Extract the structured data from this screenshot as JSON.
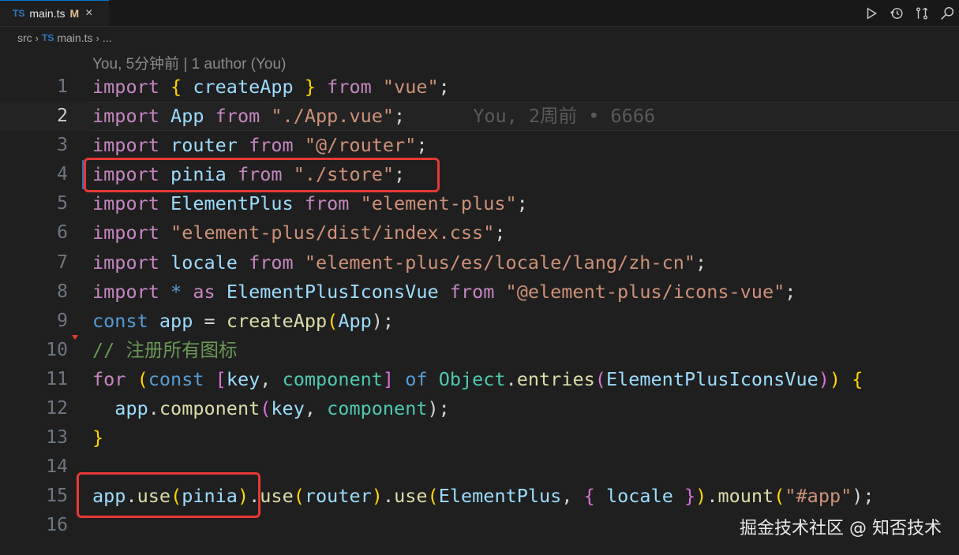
{
  "tab": {
    "badge": "TS",
    "name": "main.ts",
    "modified": "M",
    "close": "×"
  },
  "breadcrumb": {
    "folder": "src",
    "sep1": "›",
    "badge": "TS",
    "file": "main.ts",
    "sep2": "›",
    "more": "..."
  },
  "toolbar": {
    "icons": [
      "run-icon",
      "history-icon",
      "compare-icon",
      "open-changes-icon"
    ]
  },
  "blame_header": "You, 5分钟前 | 1 author (You)",
  "inline_blame": "You, 2周前 • 6666",
  "watermark": "掘金技术社区 @ 知否技术",
  "line_numbers": [
    "1",
    "2",
    "3",
    "4",
    "5",
    "6",
    "7",
    "8",
    "9",
    "10",
    "11",
    "12",
    "13",
    "14",
    "15",
    "16"
  ],
  "code": {
    "l1": [
      "import",
      " ",
      "{",
      " ",
      "createApp",
      " ",
      "}",
      " ",
      "from",
      " ",
      "\"vue\"",
      ";"
    ],
    "l2": [
      "import",
      " ",
      "App",
      " ",
      "from",
      " ",
      "\"./App.vue\"",
      ";"
    ],
    "l3": [
      "import",
      " ",
      "router",
      " ",
      "from",
      " ",
      "\"@/router\"",
      ";"
    ],
    "l4": [
      "import",
      " ",
      "pinia",
      " ",
      "from",
      " ",
      "\"./store\"",
      ";"
    ],
    "l5": [
      "import",
      " ",
      "ElementPlus",
      " ",
      "from",
      " ",
      "\"element-plus\"",
      ";"
    ],
    "l6": [
      "import",
      " ",
      "\"element-plus/dist/index.css\"",
      ";"
    ],
    "l7": [
      "import",
      " ",
      "locale",
      " ",
      "from",
      " ",
      "\"element-plus/es/locale/lang/zh-cn\"",
      ";"
    ],
    "l8": [
      "import",
      " ",
      "*",
      " ",
      "as",
      " ",
      "ElementPlusIconsVue",
      " ",
      "from",
      " ",
      "\"@element-plus/icons-vue\"",
      ";"
    ],
    "l9": [
      "const",
      " ",
      "app",
      " = ",
      "createApp",
      "(",
      "App",
      ");"
    ],
    "l10": [
      "// 注册所有图标"
    ],
    "l11": [
      "for",
      " ",
      "(",
      "const",
      " ",
      "[",
      "key",
      ", ",
      "component",
      "]",
      " ",
      "of",
      " ",
      "Object",
      ".",
      "entries",
      "(",
      "ElementPlusIconsVue",
      ")",
      ")",
      " ",
      "{"
    ],
    "l12": [
      "  ",
      "app",
      ".",
      "component",
      "(",
      "key",
      ", ",
      "component",
      ");"
    ],
    "l13": [
      "}"
    ],
    "l15": [
      "app",
      ".",
      "use",
      "(",
      "pinia",
      ")",
      ".",
      "use",
      "(",
      "router",
      ")",
      ".",
      "use",
      "(",
      "ElementPlus",
      ", ",
      "{",
      " ",
      "locale",
      " ",
      "}",
      ")",
      ".",
      "mount",
      "(",
      "\"#app\"",
      ");"
    ]
  },
  "colors": {
    "highlight_box": "#e53935",
    "accent": "#0078d4"
  }
}
